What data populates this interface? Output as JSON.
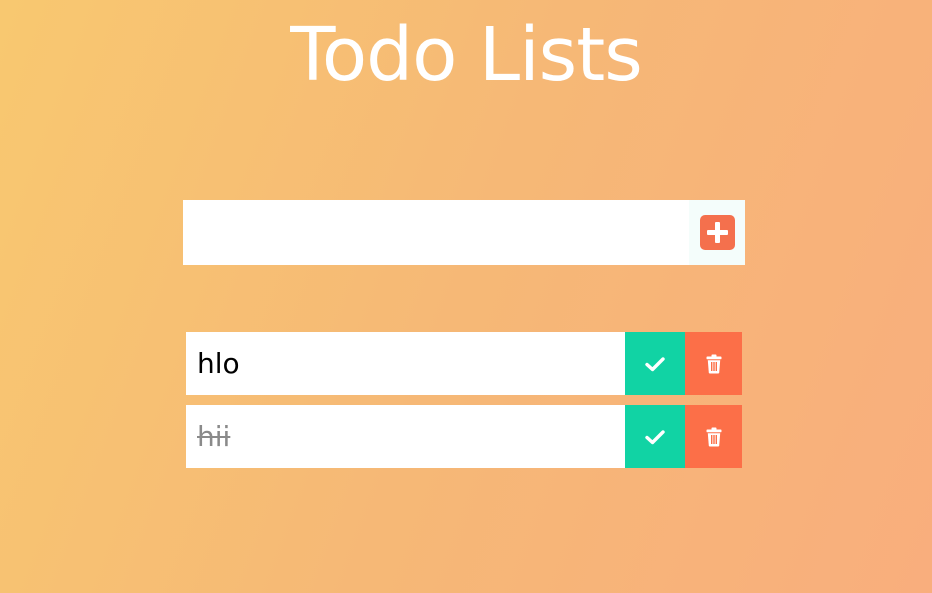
{
  "header": {
    "title": "Todo Lists"
  },
  "form": {
    "input_value": "",
    "input_placeholder": "",
    "add_icon": "plus-icon"
  },
  "todos": [
    {
      "text": "hlo",
      "completed": false
    },
    {
      "text": "hii",
      "completed": true
    }
  ],
  "colors": {
    "gradient_start": "#f8c870",
    "gradient_end": "#f9ae7d",
    "check_button": "#11d3a4",
    "trash_button": "#fc6f48",
    "add_icon": "#f4704d"
  },
  "icons": {
    "check": "check-icon",
    "trash": "trash-icon"
  }
}
